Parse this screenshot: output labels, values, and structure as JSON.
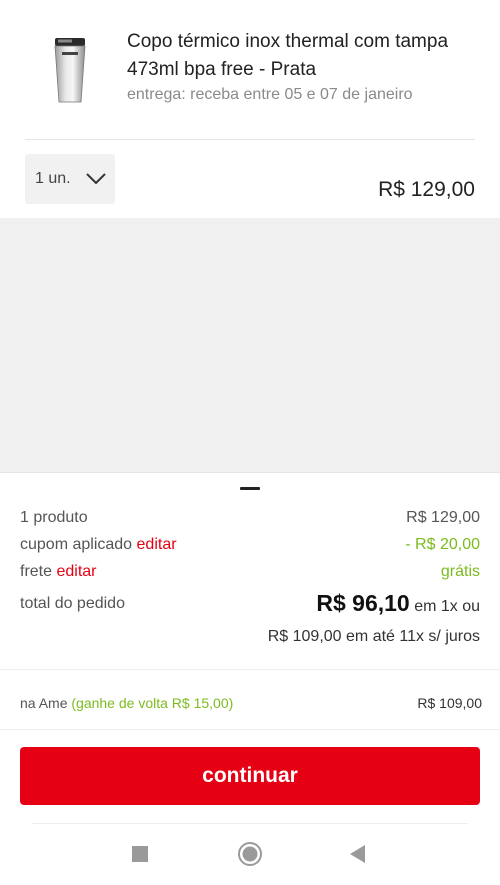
{
  "product": {
    "title": "Copo térmico inox thermal com tampa 473ml bpa free - Prata",
    "delivery": "entrega: receba entre 05 e 07 de janeiro",
    "quantity": "1 un.",
    "price": "R$ 129,00"
  },
  "summary": {
    "products_label": "1 produto",
    "products_value": "R$ 129,00",
    "coupon_label": "cupom aplicado",
    "coupon_edit": "editar",
    "coupon_value": "- R$ 20,00",
    "shipping_label": "frete",
    "shipping_edit": "editar",
    "shipping_value": "grátis",
    "total_label": "total do pedido",
    "total_value": "R$ 96,10",
    "total_suffix": "em 1x ou",
    "installments": "R$ 109,00 em até 11x s/ juros"
  },
  "ame": {
    "label": "na Ame",
    "cashback": "(ganhe de volta R$ 15,00)",
    "value": "R$ 109,00"
  },
  "continue_label": "continuar",
  "colors": {
    "accent": "#e60014",
    "green": "#7cbb1f"
  },
  "icons": [
    "chevron-down-icon",
    "nav-recent-icon",
    "nav-home-icon",
    "nav-back-icon"
  ]
}
